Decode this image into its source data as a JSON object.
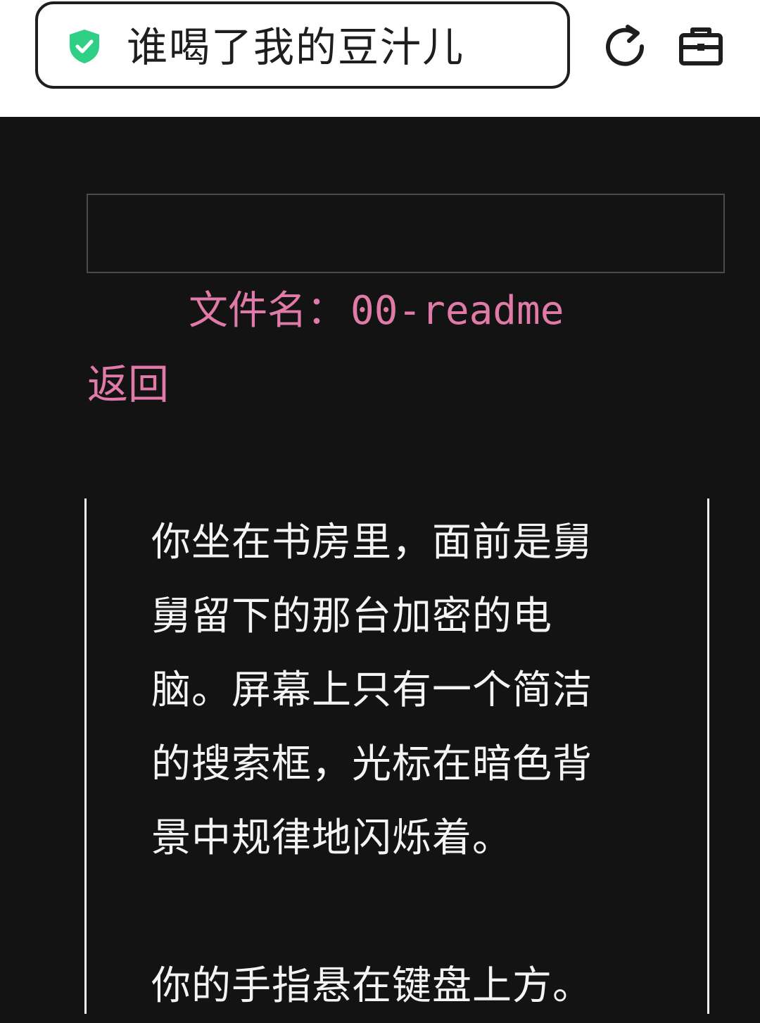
{
  "browser": {
    "title": "谁喝了我的豆汁儿",
    "icons": {
      "security": "shield-check-icon",
      "reload": "reload-icon",
      "tools": "toolbox-icon"
    }
  },
  "colors": {
    "shield": "#2fcf86",
    "accent": "#e07aa8",
    "background": "#131313",
    "text": "#f4f4f4"
  },
  "search": {
    "value": ""
  },
  "file": {
    "label": "文件名：",
    "name": "00-readme"
  },
  "nav": {
    "back_label": "返回"
  },
  "story": {
    "paragraphs": [
      "你坐在书房里，面前是舅舅留下的那台加密的电脑。屏幕上只有一个简洁的搜索框，光标在暗色背景中规律地闪烁着。",
      "你的手指悬在键盘上方。"
    ]
  }
}
